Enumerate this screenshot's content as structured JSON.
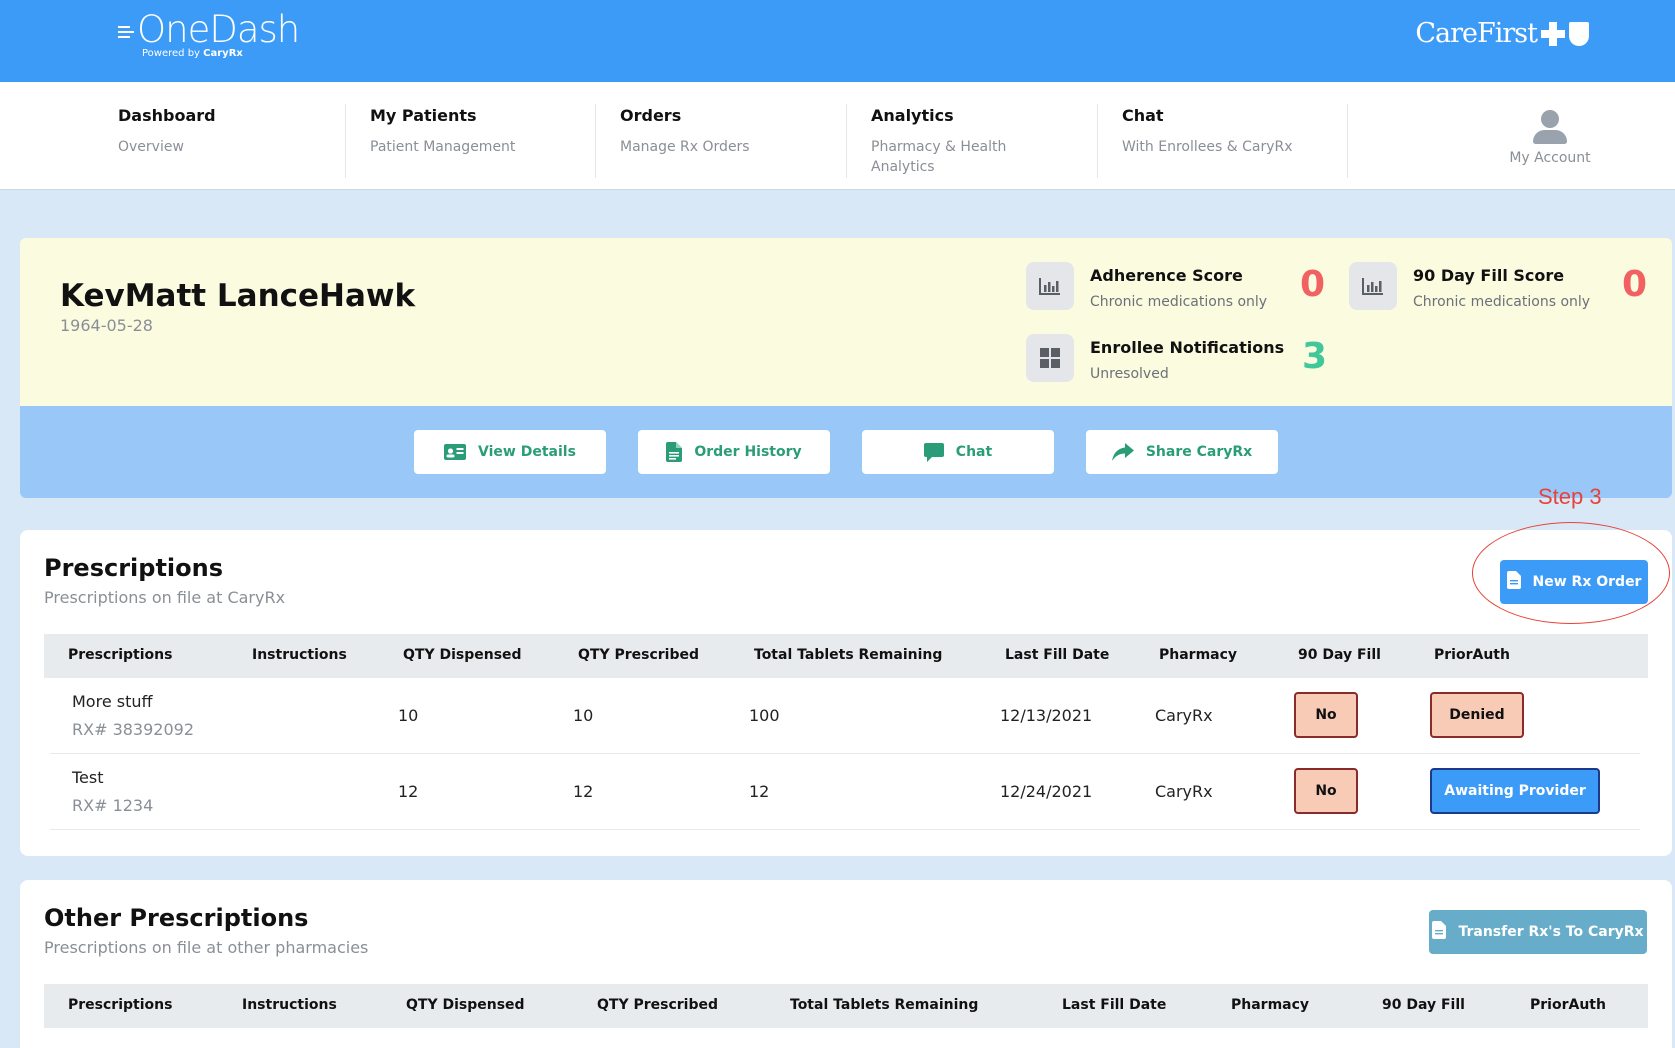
{
  "brand": {
    "logo_text": "OneDash",
    "logo_powered": "Powered by",
    "logo_powered_brand": "CaryRx",
    "partner_logo": "CareFirst"
  },
  "nav": {
    "items": [
      {
        "title": "Dashboard",
        "sub": "Overview"
      },
      {
        "title": "My Patients",
        "sub": "Patient Management"
      },
      {
        "title": "Orders",
        "sub": "Manage Rx Orders"
      },
      {
        "title": "Analytics",
        "sub": "Pharmacy & Health Analytics"
      },
      {
        "title": "Chat",
        "sub": "With Enrollees & CaryRx"
      }
    ],
    "account_label": "My Account",
    "account_icon": "user-icon"
  },
  "patient": {
    "name": "KevMatt LanceHawk",
    "dob": "1964-05-28",
    "metrics": {
      "adherence": {
        "title": "Adherence Score",
        "sub": "Chronic medications only",
        "value": "0",
        "icon": "chart-icon",
        "color": "#f16161"
      },
      "fill90": {
        "title": "90 Day Fill Score",
        "sub": "Chronic medications only",
        "value": "0",
        "icon": "chart-icon",
        "color": "#f16161"
      },
      "notifications": {
        "title": "Enrollee Notifications",
        "sub": "Unresolved",
        "value": "3",
        "icon": "grid-icon",
        "color": "#41c79a"
      }
    }
  },
  "actions": {
    "view_details": "View Details",
    "order_history": "Order History",
    "chat": "Chat",
    "share": "Share CaryRx"
  },
  "annotation": {
    "step_label": "Step 3",
    "color": "#e6433a"
  },
  "prescriptions": {
    "title": "Prescriptions",
    "subtitle": "Prescriptions on file at CaryRx",
    "new_order_label": "New Rx Order",
    "columns": [
      "Prescriptions",
      "Instructions",
      "QTY Dispensed",
      "QTY Prescribed",
      "Total Tablets Remaining",
      "Last Fill Date",
      "Pharmacy",
      "90 Day Fill",
      "PriorAuth"
    ],
    "rows": [
      {
        "name": "More stuff",
        "rx": "RX# 38392092",
        "instructions": "",
        "qty_dispensed": "10",
        "qty_prescribed": "10",
        "remaining": "100",
        "last_fill": "12/13/2021",
        "pharmacy": "CaryRx",
        "day90": "No",
        "prior_auth": "Denied"
      },
      {
        "name": "Test",
        "rx": "RX# 1234",
        "instructions": "",
        "qty_dispensed": "12",
        "qty_prescribed": "12",
        "remaining": "12",
        "last_fill": "12/24/2021",
        "pharmacy": "CaryRx",
        "day90": "No",
        "prior_auth": "Awaiting Provider"
      }
    ]
  },
  "other_prescriptions": {
    "title": "Other Prescriptions",
    "subtitle": "Prescriptions on file at other pharmacies",
    "transfer_label": "Transfer Rx's To CaryRx",
    "columns": [
      "Prescriptions",
      "Instructions",
      "QTY Dispensed",
      "QTY Prescribed",
      "Total Tablets Remaining",
      "Last Fill Date",
      "Pharmacy",
      "90 Day Fill",
      "PriorAuth"
    ]
  },
  "colors": {
    "primary": "#3d9bf8",
    "accent_green": "#2a9d78",
    "patient_card_bg": "#fbfbe0",
    "action_band_bg": "#99c8f8",
    "transfer_button": "#67acc9"
  }
}
